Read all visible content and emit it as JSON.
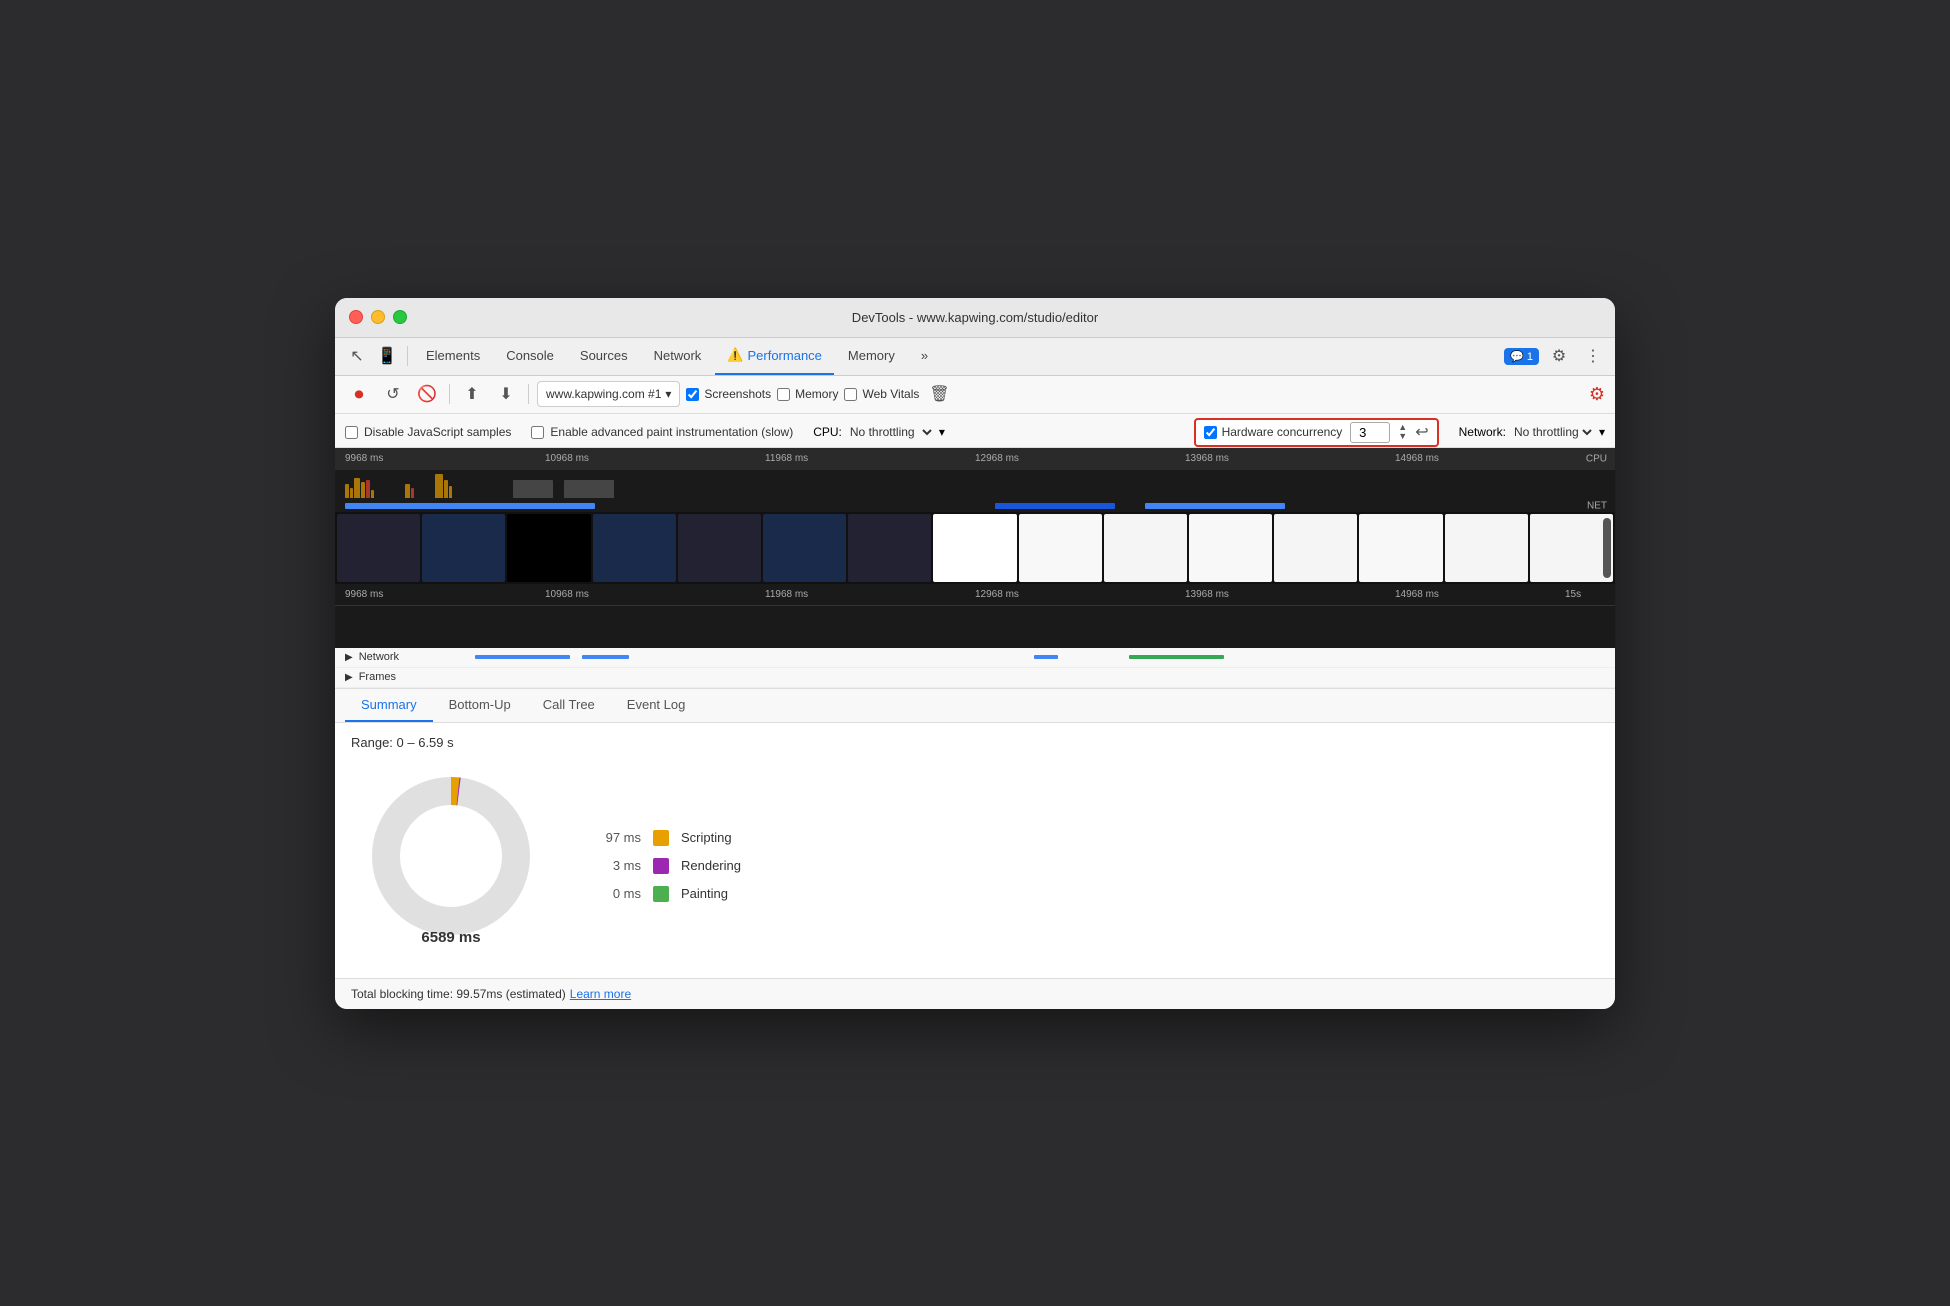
{
  "window": {
    "title": "DevTools - www.kapwing.com/studio/editor"
  },
  "nav": {
    "tabs": [
      {
        "label": "Elements",
        "active": false
      },
      {
        "label": "Console",
        "active": false
      },
      {
        "label": "Sources",
        "active": false
      },
      {
        "label": "Network",
        "active": false
      },
      {
        "label": "Performance",
        "active": true
      },
      {
        "label": "Memory",
        "active": false
      }
    ],
    "more_label": "»",
    "badge_label": "💬 1",
    "performance_warning": "⚠️"
  },
  "toolbar": {
    "record_title": "Record",
    "reload_title": "Reload and start profiling",
    "clear_title": "Clear recording",
    "upload_title": "Load profile",
    "download_title": "Save profile",
    "selector_value": "www.kapwing.com #1",
    "screenshots_label": "Screenshots",
    "screenshots_checked": true,
    "memory_label": "Memory",
    "memory_checked": false,
    "webvitals_label": "Web Vitals",
    "webvitals_checked": false,
    "trash_title": "Delete profile",
    "settings_title": "Capture settings"
  },
  "options": {
    "disable_js_samples_label": "Disable JavaScript samples",
    "disable_js_samples_checked": false,
    "advanced_paint_label": "Enable advanced paint instrumentation (slow)",
    "advanced_paint_checked": false,
    "cpu_label": "CPU:",
    "cpu_value": "No throttling",
    "network_label": "Network:",
    "network_value": "No throttling",
    "hw_concurrency_checked": true,
    "hw_concurrency_label": "Hardware concurrency",
    "hw_concurrency_value": "3"
  },
  "timeline": {
    "time_labels_top": [
      "9968 ms",
      "10968 ms",
      "11968 ms",
      "12968 ms",
      "13968 ms",
      "14968 ms"
    ],
    "time_labels_bottom": [
      "9968 ms",
      "10968 ms",
      "11968 ms",
      "12968 ms",
      "13968 ms",
      "14968 ms",
      "15s"
    ],
    "cpu_label": "CPU",
    "net_label": "NET"
  },
  "perf_rows": {
    "network_label": "▶ Network",
    "frames_label": "▶ Frames"
  },
  "bottom_tabs": [
    {
      "label": "Summary",
      "active": true
    },
    {
      "label": "Bottom-Up",
      "active": false
    },
    {
      "label": "Call Tree",
      "active": false
    },
    {
      "label": "Event Log",
      "active": false
    }
  ],
  "summary": {
    "range_label": "Range: 0 – 6.59 s",
    "donut_center": "6589 ms",
    "legend": [
      {
        "value": "97 ms",
        "color": "#e8a000",
        "label": "Scripting"
      },
      {
        "value": "3 ms",
        "color": "#9c27b0",
        "label": "Rendering"
      },
      {
        "value": "0 ms",
        "color": "#4caf50",
        "label": "Painting"
      }
    ]
  },
  "status_bar": {
    "text": "Total blocking time: 99.57ms (estimated)",
    "link_text": "Learn more"
  }
}
